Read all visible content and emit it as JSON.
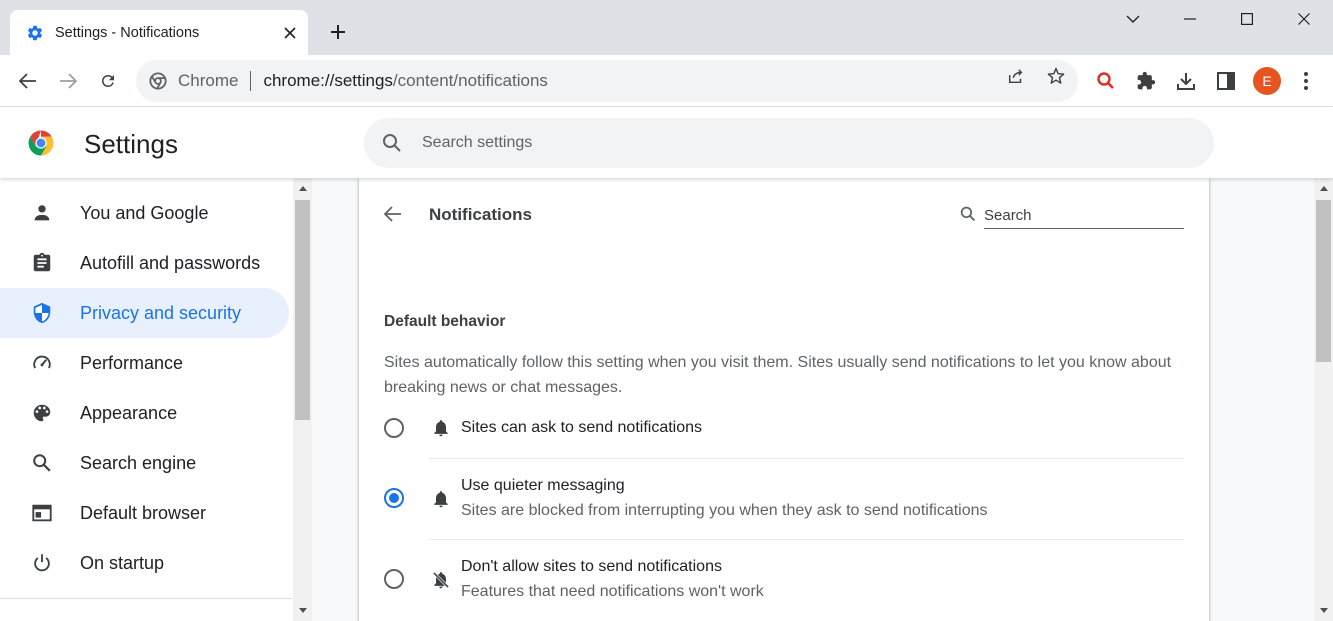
{
  "browser": {
    "tab_title": "Settings - Notifications",
    "omnibox_chip": "Chrome",
    "url_host": "chrome://settings",
    "url_path": "/content/notifications",
    "avatar_letter": "E"
  },
  "settings": {
    "title": "Settings",
    "search_placeholder": "Search settings"
  },
  "sidebar": {
    "items": [
      {
        "label": "You and Google",
        "icon": "person-icon"
      },
      {
        "label": "Autofill and passwords",
        "icon": "clipboard-icon"
      },
      {
        "label": "Privacy and security",
        "icon": "shield-icon",
        "active": true
      },
      {
        "label": "Performance",
        "icon": "speedometer-icon"
      },
      {
        "label": "Appearance",
        "icon": "palette-icon"
      },
      {
        "label": "Search engine",
        "icon": "search-icon"
      },
      {
        "label": "Default browser",
        "icon": "browser-window-icon"
      },
      {
        "label": "On startup",
        "icon": "power-icon"
      }
    ]
  },
  "page": {
    "title": "Notifications",
    "search_placeholder": "Search",
    "section_heading": "Default behavior",
    "section_description": "Sites automatically follow this setting when you visit them. Sites usually send notifications to let you know about breaking news or chat messages.",
    "options": [
      {
        "label": "Sites can ask to send notifications",
        "sublabel": "",
        "checked": false,
        "icon": "bell-icon"
      },
      {
        "label": "Use quieter messaging",
        "sublabel": "Sites are blocked from interrupting you when they ask to send notifications",
        "checked": true,
        "icon": "bell-icon"
      },
      {
        "label": "Don't allow sites to send notifications",
        "sublabel": "Features that need notifications won't work",
        "checked": false,
        "icon": "bell-off-icon"
      }
    ]
  },
  "colors": {
    "accent": "#1a73e8",
    "active_bg": "#e8f0fe",
    "avatar": "#e8541f"
  }
}
